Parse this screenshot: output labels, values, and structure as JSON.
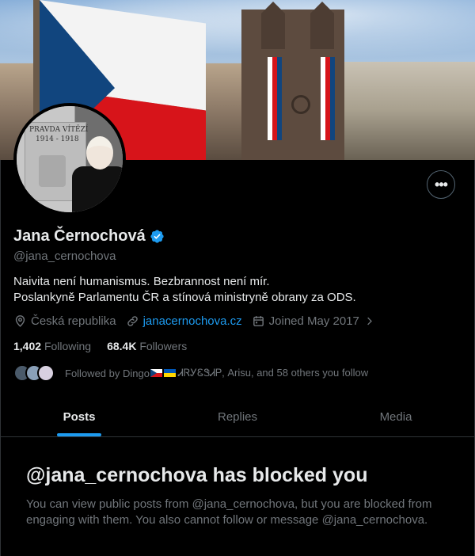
{
  "profile": {
    "display_name": "Jana Černochová",
    "handle": "@jana_cernochova",
    "bio_line1": "Naivita není humanismus. Bezbrannost není mír.",
    "bio_line2": "Poslankyně Parlamentu ČR a stínová ministryně obrany za ODS.",
    "location": "Česká republika",
    "website": "janacernochova.cz",
    "joined": "Joined May 2017",
    "following_count": "1,402",
    "following_label": "Following",
    "followers_count": "68.4K",
    "followers_label": "Followers",
    "followed_by_prefix": "Followed by Dingo",
    "followed_by_suffix": "ᏗᏒᎩᏋᏕᏗᏢ, Arisu, and 58 others you follow",
    "avatar_inscription_line1": "PRAVDA VÍTĚZÍ",
    "avatar_inscription_line2": "1914 - 1918"
  },
  "tabs": [
    {
      "label": "Posts",
      "active": true
    },
    {
      "label": "Replies",
      "active": false
    },
    {
      "label": "Media",
      "active": false
    }
  ],
  "more_button": "•••",
  "blocked": {
    "title": "@jana_cernochova has blocked you",
    "message": "You can view public posts from @jana_cernochova, but you are blocked from engaging with them. You also cannot follow or message @jana_cernochova."
  },
  "colors": {
    "accent": "#1d9bf0",
    "muted": "#71767b",
    "text": "#e7e9ea",
    "background": "#000000"
  },
  "icons": [
    "location-icon",
    "link-icon",
    "calendar-icon",
    "chevron-right-icon",
    "verified-badge-icon",
    "more-icon"
  ]
}
